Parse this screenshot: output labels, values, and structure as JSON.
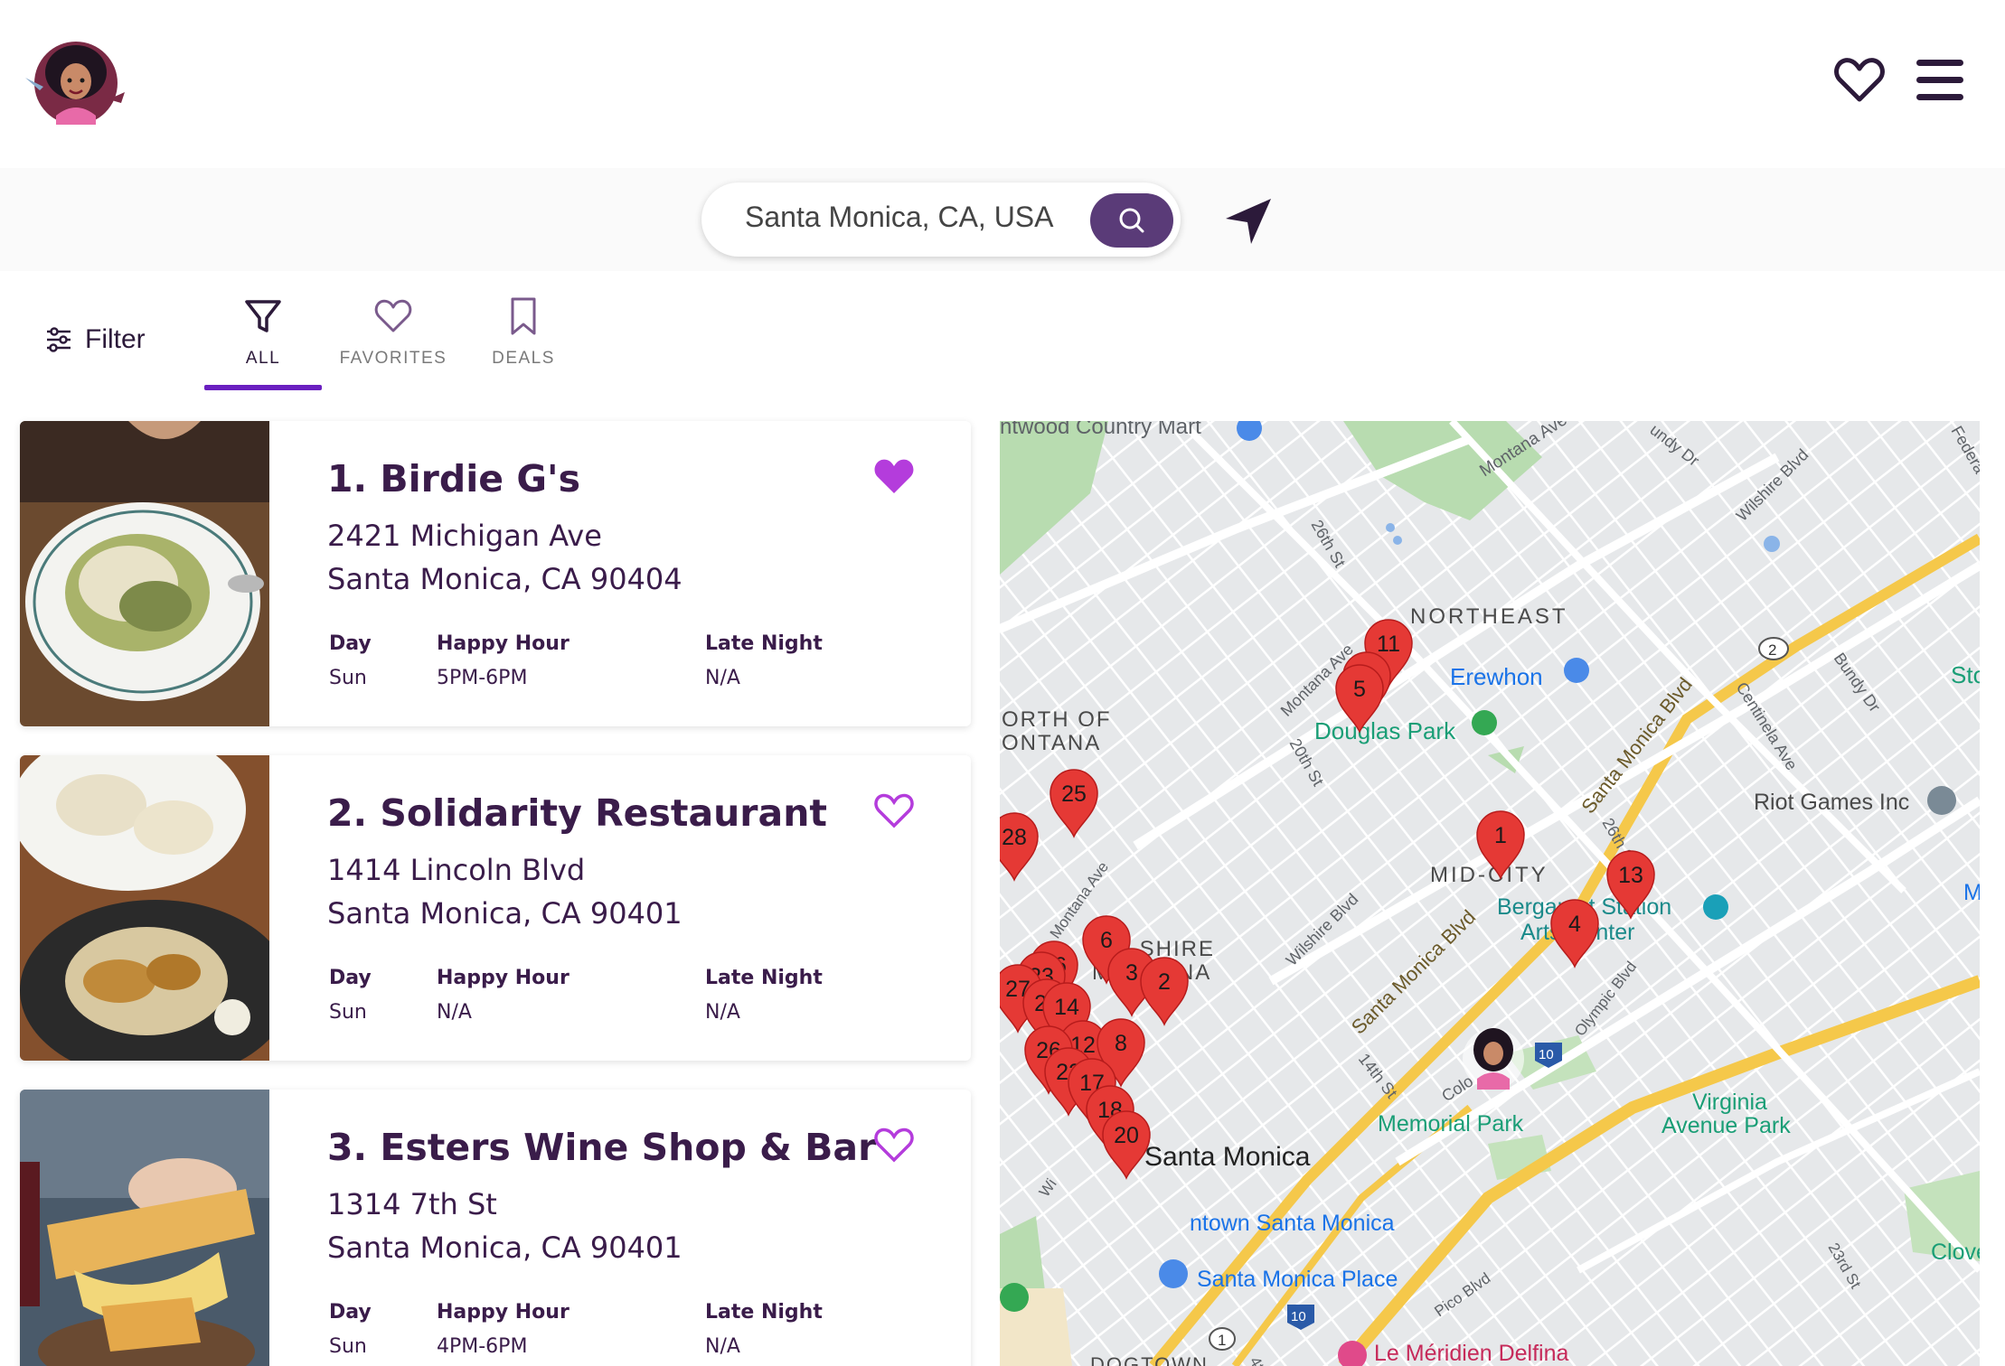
{
  "header": {
    "logo_icon": "cartoon-woman-avatar",
    "favorites_icon": "heart-outline-icon",
    "menu_icon": "hamburger-menu-icon"
  },
  "search": {
    "value": "Santa Monica, CA, USA",
    "button_icon": "search-icon",
    "locate_icon": "navigation-arrow-icon"
  },
  "filter": {
    "label": "Filter"
  },
  "tabs": [
    {
      "label": "ALL",
      "icon": "funnel-icon",
      "active": true
    },
    {
      "label": "FAVORITES",
      "icon": "heart-outline-icon",
      "active": false
    },
    {
      "label": "DEALS",
      "icon": "bookmark-icon",
      "active": false
    }
  ],
  "columns": {
    "day": "Day",
    "happy_hour": "Happy Hour",
    "late_night": "Late Night"
  },
  "restaurants": [
    {
      "name": "1. Birdie G's",
      "addr1": "2421 Michigan Ave",
      "addr2": "Santa Monica, CA 90404",
      "day": "Sun",
      "happy_hour": "5PM-6PM",
      "late_night": "N/A",
      "favorite": true
    },
    {
      "name": "2. Solidarity Restaurant",
      "addr1": "1414 Lincoln Blvd",
      "addr2": "Santa Monica, CA 90401",
      "day": "Sun",
      "happy_hour": "N/A",
      "late_night": "N/A",
      "favorite": false
    },
    {
      "name": "3. Esters Wine Shop & Bar",
      "addr1": "1314 7th St",
      "addr2": "Santa Monica, CA 90401",
      "day": "Sun",
      "happy_hour": "4PM-6PM",
      "late_night": "N/A",
      "favorite": false
    }
  ],
  "map": {
    "labels": {
      "country_mart": "ntwood Country Mart",
      "montana_ave_top": "Montana Ave",
      "sundy": "undy Dr",
      "wilshire_top": "Wilshire Blvd",
      "federal": "Federa",
      "st26": "26th St",
      "northeast": "NORTHEAST",
      "erewhon": "Erewhon",
      "montana_ave_mid": "Montana Ave",
      "bundy": "Bundy Dr",
      "sto": "Sto",
      "north_of": "ORTH OF",
      "montana_caps": "ONTANA",
      "douglas_park": "Douglas Park",
      "st20": "20th St",
      "centinela": "Centinela Ave",
      "sm_blvd_top": "Santa Monica Blvd",
      "riot": "Riot Games Inc",
      "st26b": "26th St",
      "mid_city": "MID-CITY",
      "bergamot1": "Bergamot Station",
      "bergamot2": "Arts Center",
      "m_right": "M",
      "montana_ave_left": "Montana Ave",
      "wilshire_caps1": "WILSHIRE",
      "wilshire_caps2": "MONTANA",
      "wilshire_mid": "Wilshire Blvd",
      "sm_blvd_mid": "Santa Monica Blvd",
      "olympic": "Olympic Blvd",
      "st14": "14th St",
      "colo": "Colo",
      "memorial_park": "Memorial Park",
      "virginia1": "Virginia",
      "virginia2": "Avenue Park",
      "santa_monica": "Santa Monica",
      "downtown": "ntown Santa Monica",
      "sm_place": "Santa Monica Place",
      "pico": "Pico Blvd",
      "st23": "23rd St",
      "clover": "Clover P",
      "meridien": "Le Méridien Delfina",
      "st4": "4th",
      "dogtown": "DOGTOWN",
      "shield_2": "2",
      "shield_10a": "10",
      "shield_10b": "10",
      "shield_1": "1",
      "vd": "vd",
      "wi": "Wi"
    },
    "pins": [
      "11",
      "7",
      "5",
      "25",
      "28",
      "1",
      "13",
      "4",
      "6",
      "3",
      "2",
      "16",
      "23",
      "27",
      "21",
      "14",
      "12",
      "8",
      "26",
      "22",
      "17",
      "18",
      "20"
    ]
  }
}
